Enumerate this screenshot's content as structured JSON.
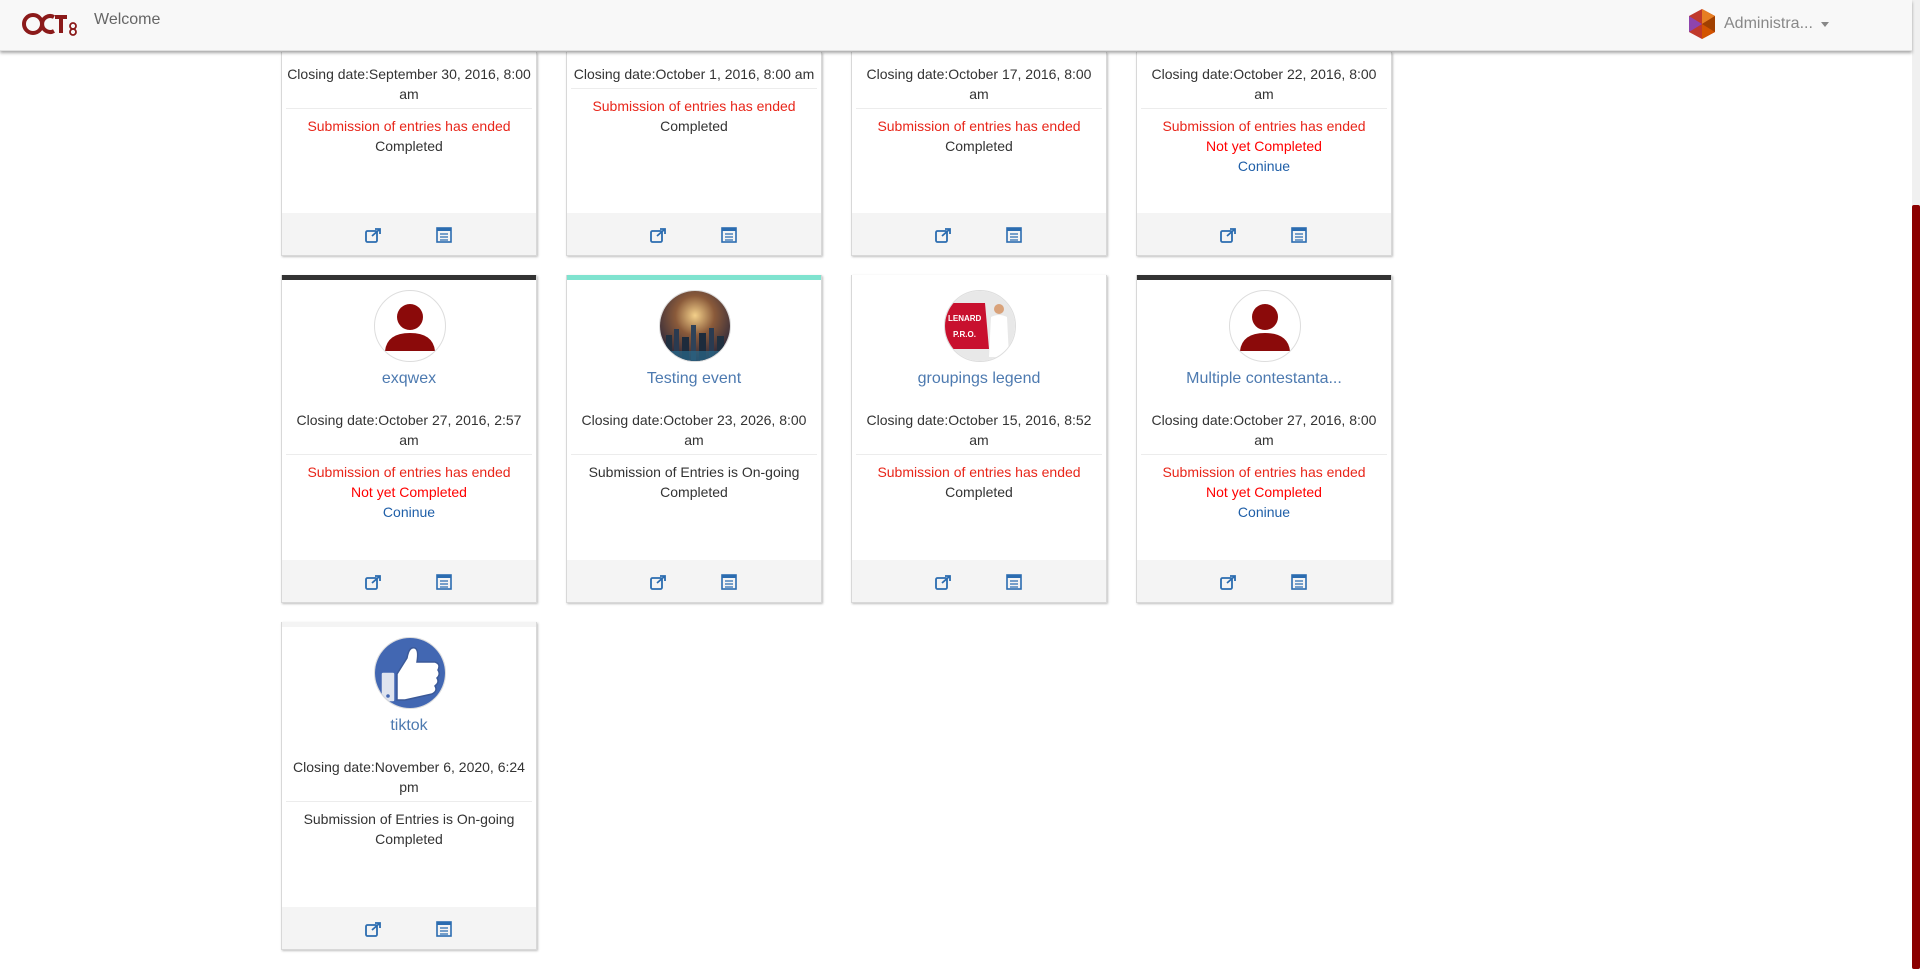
{
  "navbar": {
    "logo_text": "OCT8",
    "title": "Welcome",
    "user_name": "Administra..."
  },
  "colors": {
    "accent": "#8b0000",
    "link": "#4d7ab0",
    "alert": "#e8261a",
    "teal": "#7fe3cf",
    "dark": "#333333"
  },
  "cards_row0": [
    {
      "closing": "Closing date:September 30, 2016, 8:00 am",
      "submission": "Submission of entries has ended",
      "status": "Completed",
      "continue": ""
    },
    {
      "closing": "Closing date:October 1, 2016, 8:00 am",
      "submission": "Submission of entries has ended",
      "status": "Completed",
      "continue": ""
    },
    {
      "closing": "Closing date:October 17, 2016, 8:00 am",
      "submission": "Submission of entries has ended",
      "status": "Completed",
      "continue": ""
    },
    {
      "closing": "Closing date:October 22, 2016, 8:00 am",
      "submission": "Submission of entries has ended",
      "status": "Not yet Completed",
      "continue": "Coninue"
    }
  ],
  "cards_row1": [
    {
      "name": "exqwex",
      "closing": "Closing date:October 27, 2016, 2:57 am",
      "submission": "Submission of entries has ended",
      "status": "Not yet Completed",
      "continue": "Coninue"
    },
    {
      "name": "Testing event",
      "closing": "Closing date:October 23, 2026, 8:00 am",
      "submission": "Submission of Entries is On-going",
      "status": "Completed",
      "continue": ""
    },
    {
      "name": "groupings legend",
      "closing": "Closing date:October 15, 2016, 8:52 am",
      "submission": "Submission of entries has ended",
      "status": "Completed",
      "continue": ""
    },
    {
      "name": "Multiple contestanta...",
      "closing": "Closing date:October 27, 2016, 8:00 am",
      "submission": "Submission of entries has ended",
      "status": "Not yet Completed",
      "continue": "Coninue"
    }
  ],
  "cards_row2": [
    {
      "name": "tiktok",
      "closing": "Closing date:November 6, 2020, 6:24 pm",
      "submission": "Submission of Entries is On-going",
      "status": "Completed",
      "continue": ""
    }
  ],
  "avatar_images": {
    "groupings_legend_text_1": "LENARD",
    "groupings_legend_text_2": "P.R.O."
  }
}
